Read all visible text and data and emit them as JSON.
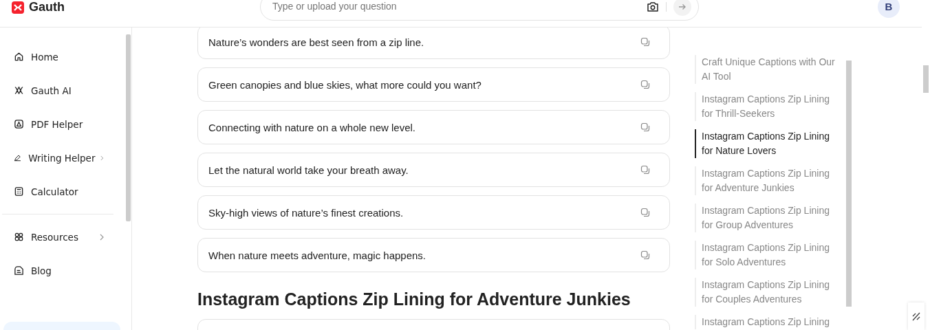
{
  "header": {
    "logo": "Gauth",
    "search": {
      "placeholder": "Type or upload your question"
    },
    "avatar": "B"
  },
  "sidebar": {
    "items": [
      {
        "label": "Home",
        "kind": "home",
        "submenu": false
      },
      {
        "label": "Gauth AI",
        "kind": "ai",
        "submenu": false
      },
      {
        "label": "PDF Helper",
        "kind": "pdf",
        "submenu": false
      },
      {
        "label": "Writing Helper",
        "kind": "pen",
        "submenu": true
      },
      {
        "label": "Calculator",
        "kind": "calc",
        "submenu": false
      },
      {
        "label": "Resources",
        "kind": "grid",
        "submenu": true,
        "divider_before": true
      },
      {
        "label": "Blog",
        "kind": "blog",
        "submenu": false
      }
    ]
  },
  "captions": [
    "Nature’s wonders are best seen from a zip line.",
    "Green canopies and blue skies, what more could you want?",
    "Connecting with nature on a whole new level.",
    "Let the natural world take your breath away.",
    "Sky-high views of nature’s finest creations.",
    "When nature meets adventure, magic happens."
  ],
  "section_heading": "Instagram Captions Zip Lining for Adventure Junkies",
  "toc": [
    {
      "label": "Craft Unique Captions with Our AI Tool",
      "selected": false
    },
    {
      "label": "Instagram Captions Zip Lining for Thrill-Seekers",
      "selected": false
    },
    {
      "label": "Instagram Captions Zip Lining for Nature Lovers",
      "selected": true
    },
    {
      "label": "Instagram Captions Zip Lining for Adventure Junkies",
      "selected": false
    },
    {
      "label": "Instagram Captions Zip Lining for Group Adventures",
      "selected": false
    },
    {
      "label": "Instagram Captions Zip Lining for Solo Adventures",
      "selected": false
    },
    {
      "label": "Instagram Captions Zip Lining for Couples Adventures",
      "selected": false
    },
    {
      "label": "Instagram Captions Zip Lining",
      "selected": false
    }
  ]
}
